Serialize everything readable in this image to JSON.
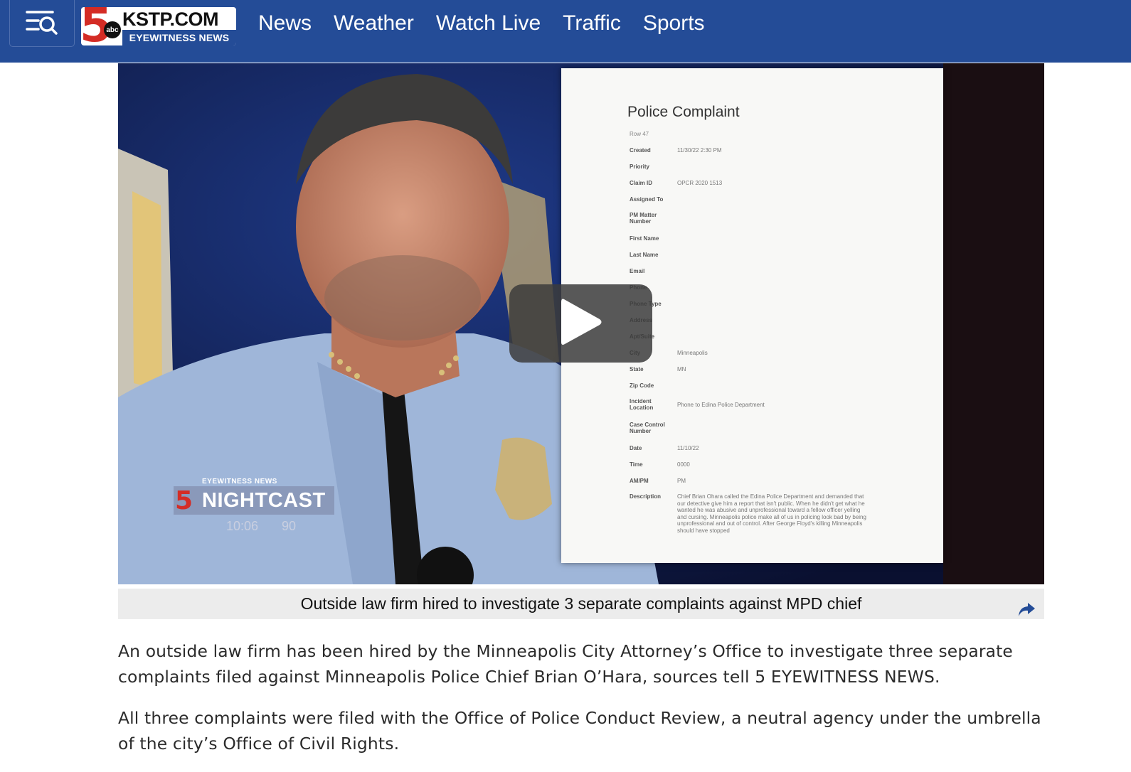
{
  "header": {
    "menu_icon": "menu-search-icon",
    "logo": {
      "number": "5",
      "network": "abc",
      "site": "KSTP.COM",
      "subtitle": "EYEWITNESS NEWS"
    },
    "nav": [
      "News",
      "Weather",
      "Watch Live",
      "Traffic",
      "Sports"
    ],
    "brand_color": "#244c97",
    "accent_color": "#d42c25"
  },
  "video": {
    "play_icon": "play-icon",
    "document": {
      "title": "Police Complaint",
      "row_label": "Row 47",
      "fields": [
        {
          "label": "Created",
          "value": "11/30/22 2:30 PM"
        },
        {
          "label": "Priority",
          "value": ""
        },
        {
          "label": "Claim ID",
          "value": "OPCR 2020 1513"
        },
        {
          "label": "Assigned To",
          "value": ""
        },
        {
          "label": "PM Matter Number",
          "value": ""
        },
        {
          "label": "First Name",
          "value": ""
        },
        {
          "label": "Last Name",
          "value": ""
        },
        {
          "label": "Email",
          "value": ""
        },
        {
          "label": "Phone",
          "value": ""
        },
        {
          "label": "Phone Type",
          "value": ""
        },
        {
          "label": "Address",
          "value": ""
        },
        {
          "label": "Apt/Suite",
          "value": ""
        },
        {
          "label": "City",
          "value": "Minneapolis"
        },
        {
          "label": "State",
          "value": "MN"
        },
        {
          "label": "Zip Code",
          "value": ""
        },
        {
          "label": "Incident Location",
          "value": "Phone to Edina Police Department"
        },
        {
          "label": "Case Control Number",
          "value": ""
        },
        {
          "label": "Date",
          "value": "11/10/22"
        },
        {
          "label": "Time",
          "value": "0000"
        },
        {
          "label": "AM/PM",
          "value": "PM"
        },
        {
          "label": "Description",
          "value": ""
        }
      ],
      "description": "Chief Brian Ohara called the Edina Police Department and demanded that our detective give him a report that isn't public. When he didn't get what he wanted he was abusive and unprofessional toward a fellow officer yelling and cursing. Minneapolis police make all of us in policing look bad by being unprofessional and out of control. After George Floyd's killing Minneapolis should have stopped"
    },
    "bug": {
      "eyebrow": "EYEWITNESS NEWS",
      "number": "5",
      "show": "NIGHTCAST",
      "time": "10:06",
      "temp": "90"
    }
  },
  "caption": {
    "text": "Outside law firm hired to investigate 3 separate complaints against MPD chief",
    "share_icon": "share-icon"
  },
  "article": {
    "paragraphs": [
      "An outside law firm has been hired by the Minneapolis City Attorney’s Office to investigate three separate complaints filed against Minneapolis Police Chief Brian O’Hara, sources tell 5 EYEWITNESS NEWS.",
      "All three complaints were filed with the Office of Police Conduct Review, a neutral agency under the umbrella of the city’s Office of Civil Rights."
    ]
  }
}
